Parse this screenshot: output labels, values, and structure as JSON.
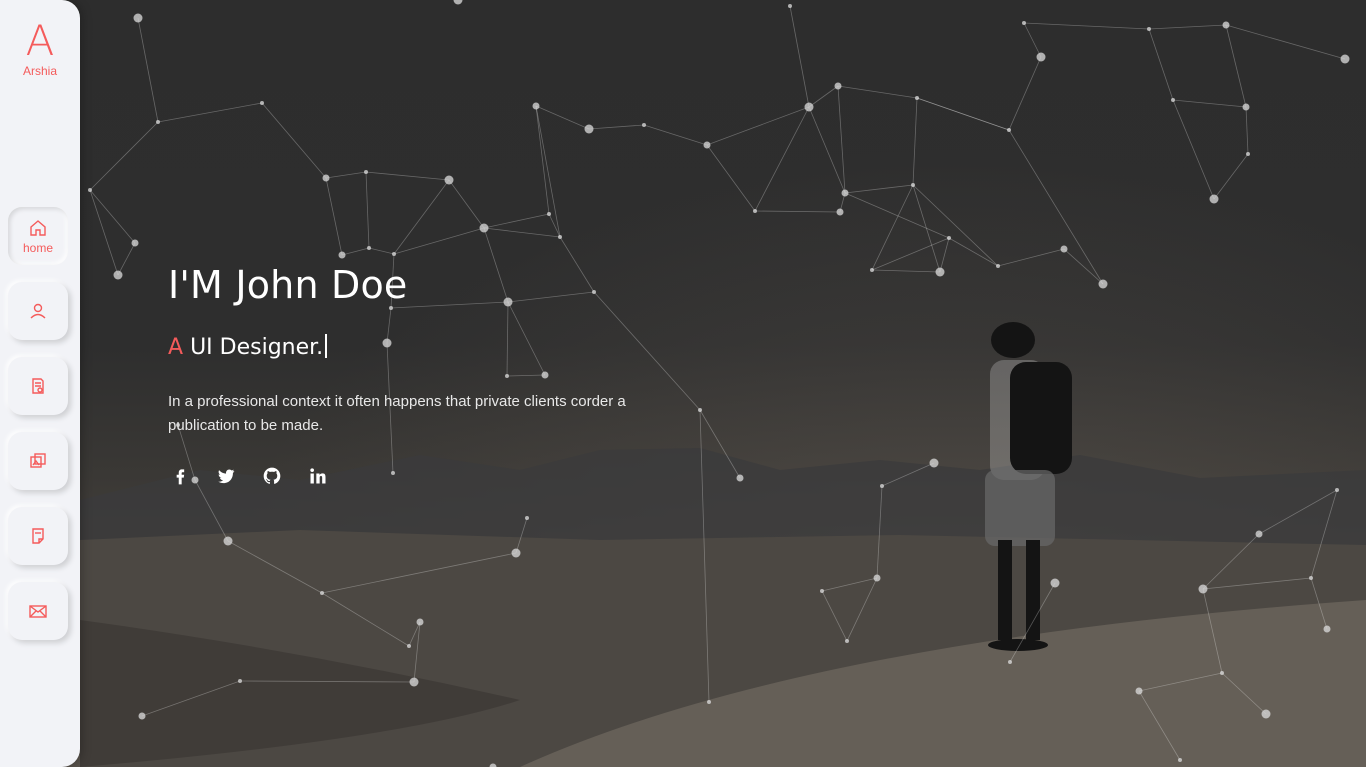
{
  "brand": {
    "letter": "A",
    "name": "Arshia"
  },
  "nav": [
    {
      "label": "home",
      "icon": "home-icon",
      "active": true
    },
    {
      "label": "",
      "icon": "user-icon"
    },
    {
      "label": "",
      "icon": "resume-icon"
    },
    {
      "label": "",
      "icon": "portfolio-icon"
    },
    {
      "label": "",
      "icon": "blog-icon"
    },
    {
      "label": "",
      "icon": "mail-icon"
    }
  ],
  "hero": {
    "title": "I'M John Doe",
    "subtitle_accent": "A",
    "subtitle_text": "UI Designer.",
    "description": "In a professional context it often happens that private clients corder a publication to be made."
  },
  "social": [
    {
      "name": "facebook",
      "icon": "facebook-icon"
    },
    {
      "name": "twitter",
      "icon": "twitter-icon"
    },
    {
      "name": "github",
      "icon": "github-icon"
    },
    {
      "name": "linkedin",
      "icon": "linkedin-icon"
    }
  ],
  "colors": {
    "accent": "#f45b5b",
    "sidebar": "#f2f3f7",
    "overlay": "#2d2d2d"
  }
}
